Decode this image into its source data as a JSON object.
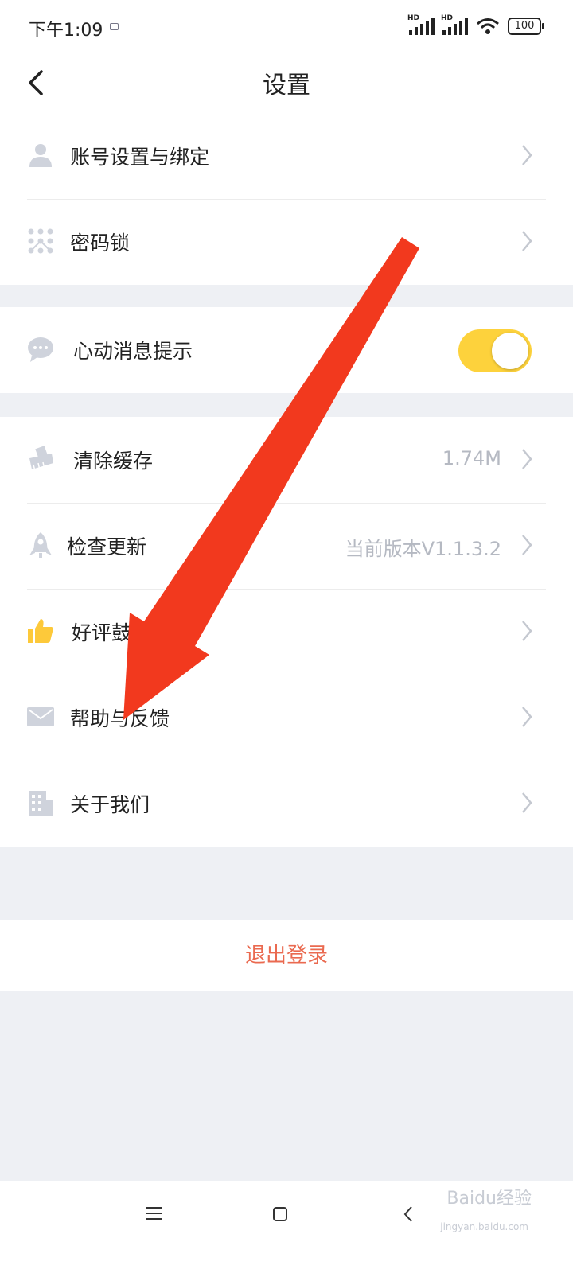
{
  "status_bar": {
    "time": "下午1:09",
    "signal1_label": "HD",
    "signal2_label": "HD",
    "battery": "100"
  },
  "header": {
    "title": "设置"
  },
  "groups": {
    "account": [
      {
        "label": "账号设置与绑定",
        "icon": "user-icon"
      },
      {
        "label": "密码锁",
        "icon": "pattern-lock-icon"
      }
    ],
    "notify": [
      {
        "label": "心动消息提示",
        "icon": "heart-chat-icon",
        "toggle_on": true
      }
    ],
    "misc": [
      {
        "label": "清除缓存",
        "value": "1.74M",
        "icon": "broom-icon"
      },
      {
        "label": "检查更新",
        "value": "当前版本V1.1.3.2",
        "icon": "rocket-icon"
      },
      {
        "label": "好评鼓励",
        "icon": "thumbs-up-icon"
      },
      {
        "label": "帮助与反馈",
        "icon": "envelope-icon"
      },
      {
        "label": "关于我们",
        "icon": "building-icon"
      }
    ]
  },
  "logout": {
    "label": "退出登录"
  },
  "watermark": {
    "brand": "Baidu经验",
    "sub": "jingyan.baidu.com"
  },
  "colors": {
    "accent_yellow": "#fdd23c",
    "logout_red": "#ea6a50",
    "annotation_arrow": "#f2391e",
    "icon_gray": "#cfd3dc"
  }
}
